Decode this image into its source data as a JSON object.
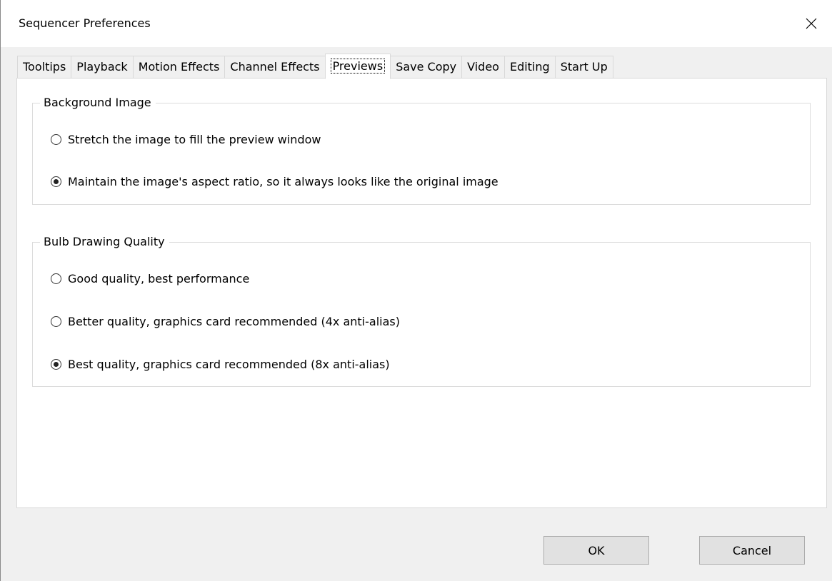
{
  "window": {
    "title": "Sequencer Preferences",
    "close_glyph": "✕"
  },
  "tabs": [
    {
      "label": "Tooltips",
      "active": false
    },
    {
      "label": "Playback",
      "active": false
    },
    {
      "label": "Motion Effects",
      "active": false
    },
    {
      "label": "Channel Effects",
      "active": false
    },
    {
      "label": "Previews",
      "active": true
    },
    {
      "label": "Save Copy",
      "active": false
    },
    {
      "label": "Video",
      "active": false
    },
    {
      "label": "Editing",
      "active": false
    },
    {
      "label": "Start Up",
      "active": false
    }
  ],
  "background_image": {
    "legend": "Background Image",
    "options": [
      {
        "label": "Stretch the image to fill the preview window",
        "selected": false
      },
      {
        "label": "Maintain the image's aspect ratio, so it always looks like the original image",
        "selected": true
      }
    ]
  },
  "bulb_quality": {
    "legend": "Bulb Drawing Quality",
    "options": [
      {
        "label": "Good quality, best performance",
        "selected": false
      },
      {
        "label": "Better quality, graphics card recommended (4x anti-alias)",
        "selected": false
      },
      {
        "label": "Best quality, graphics card recommended (8x anti-alias)",
        "selected": true
      }
    ]
  },
  "buttons": {
    "ok_label": "OK",
    "cancel_label": "Cancel"
  },
  "icons": {
    "close": "close-icon",
    "radio": "radio-button"
  }
}
